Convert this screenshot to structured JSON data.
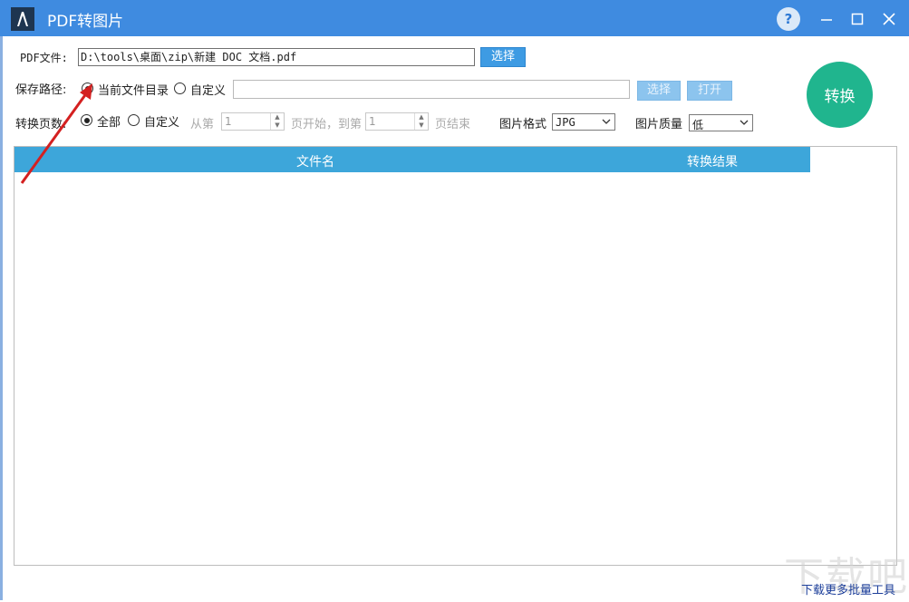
{
  "window": {
    "title": "PDF转图片"
  },
  "form": {
    "pdf_label": "PDF文件:",
    "pdf_path": "D:\\tools\\桌面\\zip\\新建 DOC 文档.pdf",
    "select_button": "选择",
    "save_label": "保存路径:",
    "save_current": "当前文件目录",
    "save_custom": "自定义",
    "save_select_button": "选择",
    "open_button": "打开",
    "pages_label": "转换页数:",
    "pages_all": "全部",
    "pages_custom": "自定义",
    "from_label": "从第",
    "from_value": "1",
    "start_to_label": "页开始，到第",
    "to_value": "1",
    "end_label": "页结束",
    "format_label": "图片格式",
    "format_value": "JPG",
    "quality_label": "图片质量",
    "quality_value": "低"
  },
  "convert_button": "转换",
  "table": {
    "headers": [
      "文件名",
      "转换结果"
    ]
  },
  "footer": {
    "link": "下载更多批量工具"
  },
  "watermark": "下载吧",
  "colors": {
    "titlebar": "#3f8be0",
    "table_header": "#3da6da",
    "convert": "#20b58e",
    "button": "#3e9be3"
  }
}
